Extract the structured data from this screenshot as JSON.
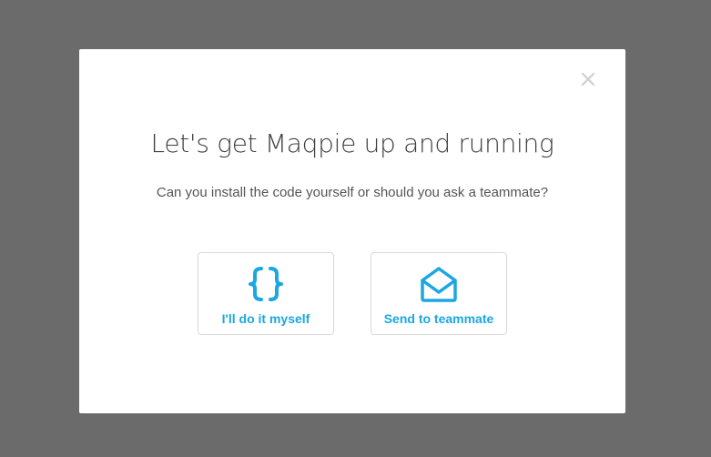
{
  "modal": {
    "title": "Let's get Maqpie up and running",
    "subtitle": "Can you install the code yourself or should you ask a teammate?",
    "close_icon": "close-icon",
    "options": [
      {
        "label": "I'll do it myself",
        "icon": "code-braces-icon"
      },
      {
        "label": "Send to teammate",
        "icon": "envelope-open-icon"
      }
    ]
  },
  "colors": {
    "overlay": "#6b6b6b",
    "accent": "#1ba7e1",
    "title": "#3f3f3f",
    "card_border": "#d9d9d9"
  }
}
